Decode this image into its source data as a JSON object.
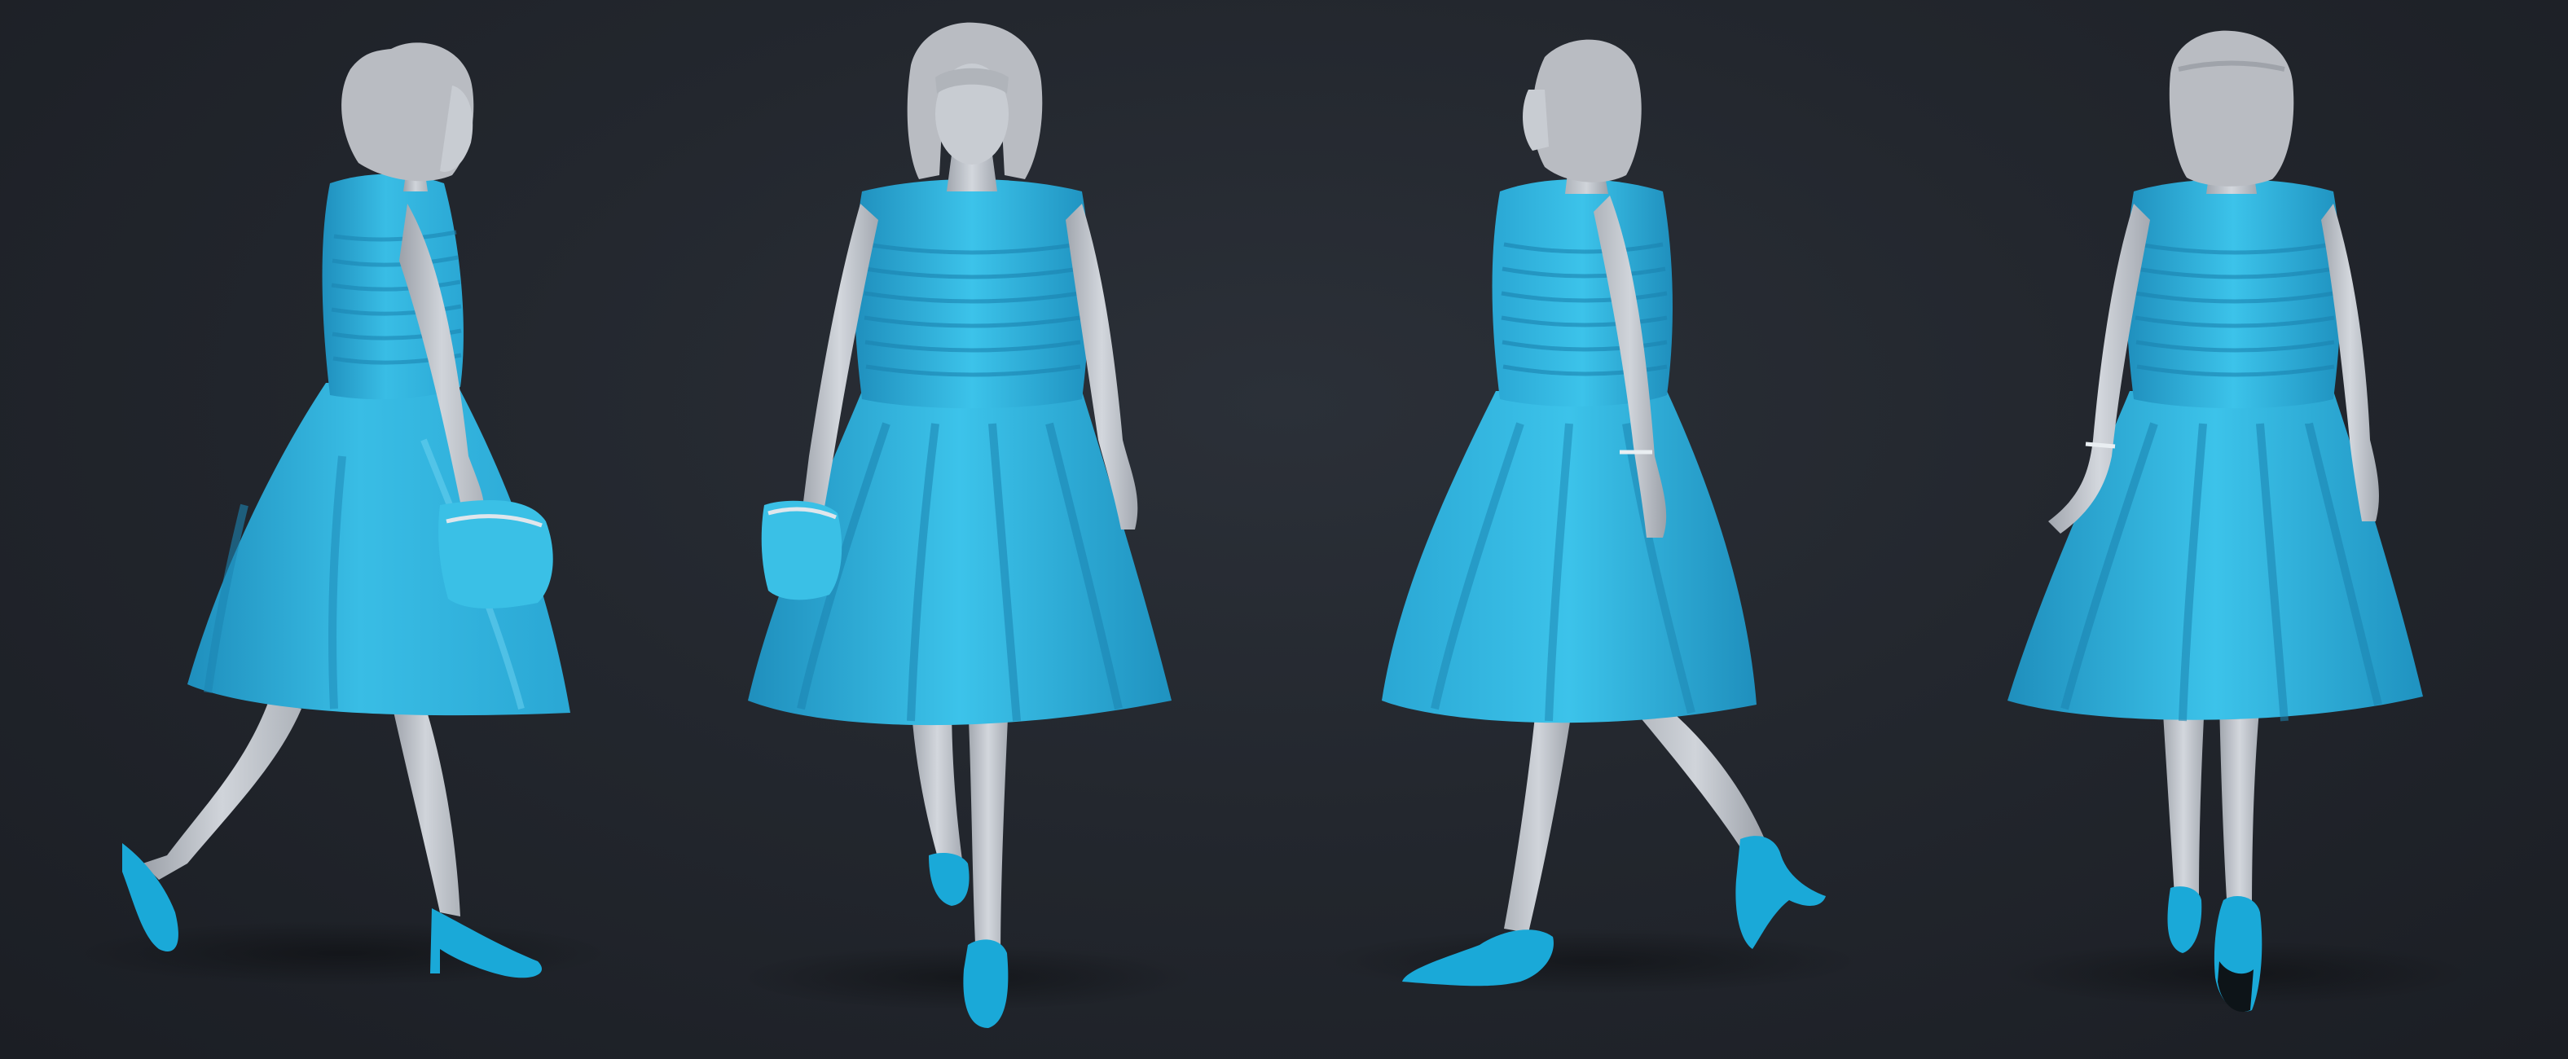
{
  "scene": {
    "background_color": "#22262d",
    "views": [
      {
        "name": "left-profile"
      },
      {
        "name": "front"
      },
      {
        "name": "right-three-quarter"
      },
      {
        "name": "back"
      }
    ]
  },
  "colors": {
    "dress": "#2eb6df",
    "dress_shadow": "#1f8fbd",
    "dress_highlight": "#7fd9f3",
    "skin": "#c8ccd2",
    "skin_shadow": "#9ca1a9",
    "hair": "#b9bcc2",
    "shoes": "#1aa9d8",
    "clutch": "#3ac0e6"
  }
}
